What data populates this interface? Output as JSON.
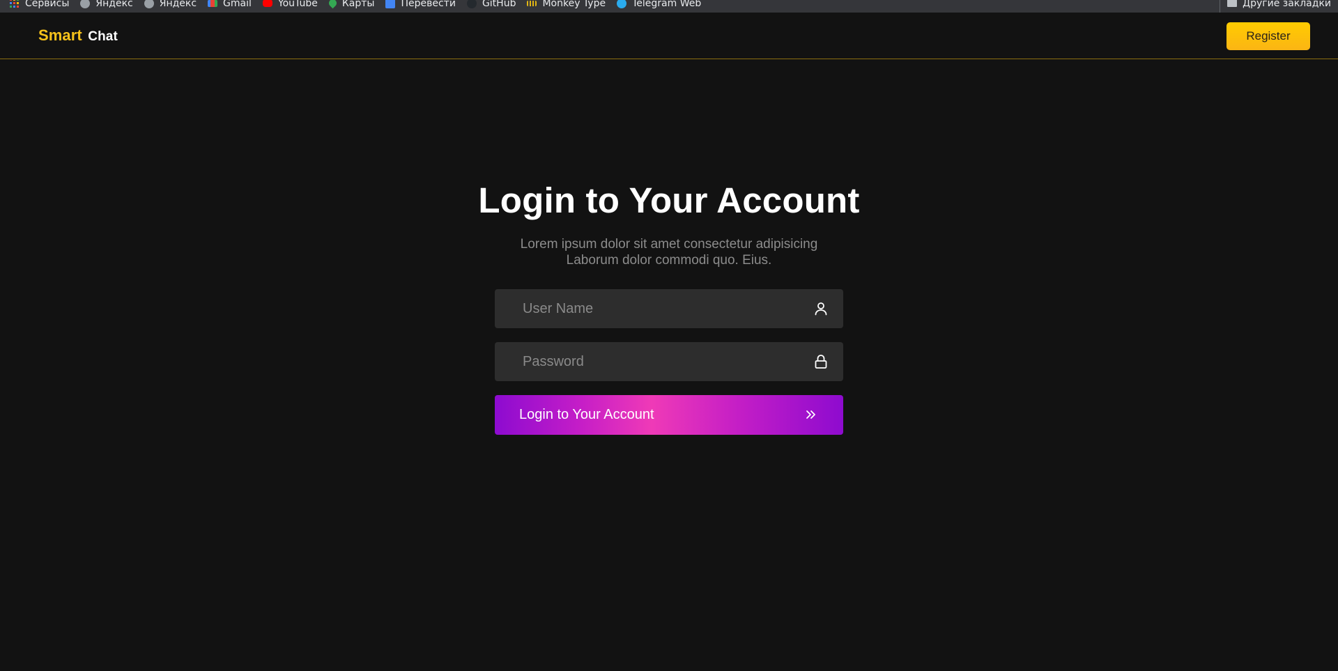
{
  "bookmarks": {
    "items": [
      {
        "label": "Сервисы",
        "icon": "apps-grid-icon",
        "color": "#f2b705"
      },
      {
        "label": "Яндекс",
        "icon": "globe-icon",
        "color": "#9aa0a6"
      },
      {
        "label": "Яндекс",
        "icon": "globe-icon",
        "color": "#9aa0a6"
      },
      {
        "label": "Gmail",
        "icon": "gmail-icon",
        "color": "#ea4335"
      },
      {
        "label": "YouTube",
        "icon": "youtube-icon",
        "color": "#ff0000"
      },
      {
        "label": "Карты",
        "icon": "maps-pin-icon",
        "color": "#34a853"
      },
      {
        "label": "Перевести",
        "icon": "translate-icon",
        "color": "#4285f4"
      },
      {
        "label": "GitHub",
        "icon": "github-icon",
        "color": "#24292e"
      },
      {
        "label": "Monkey Type",
        "icon": "monkeytype-icon",
        "color": "#e2b714"
      },
      {
        "label": "Telegram Web",
        "icon": "telegram-icon",
        "color": "#2aabee"
      }
    ],
    "other_label": "Другие закладки"
  },
  "header": {
    "logo_primary": "Smart",
    "logo_secondary": "Chat",
    "register_label": "Register"
  },
  "login": {
    "title": "Login to Your Account",
    "subtitle": "Lorem ipsum dolor sit amet consectetur adipisicing Laborum dolor commodi quo. Eius.",
    "username_placeholder": "User Name",
    "password_placeholder": "Password",
    "submit_label": "Login to Your Account"
  },
  "colors": {
    "background": "#121212",
    "accent": "#f6c21b",
    "field_bg": "#2d2d2d",
    "button_gradient_start": "#8d0bd0",
    "button_gradient_mid": "#ef3ab7"
  }
}
